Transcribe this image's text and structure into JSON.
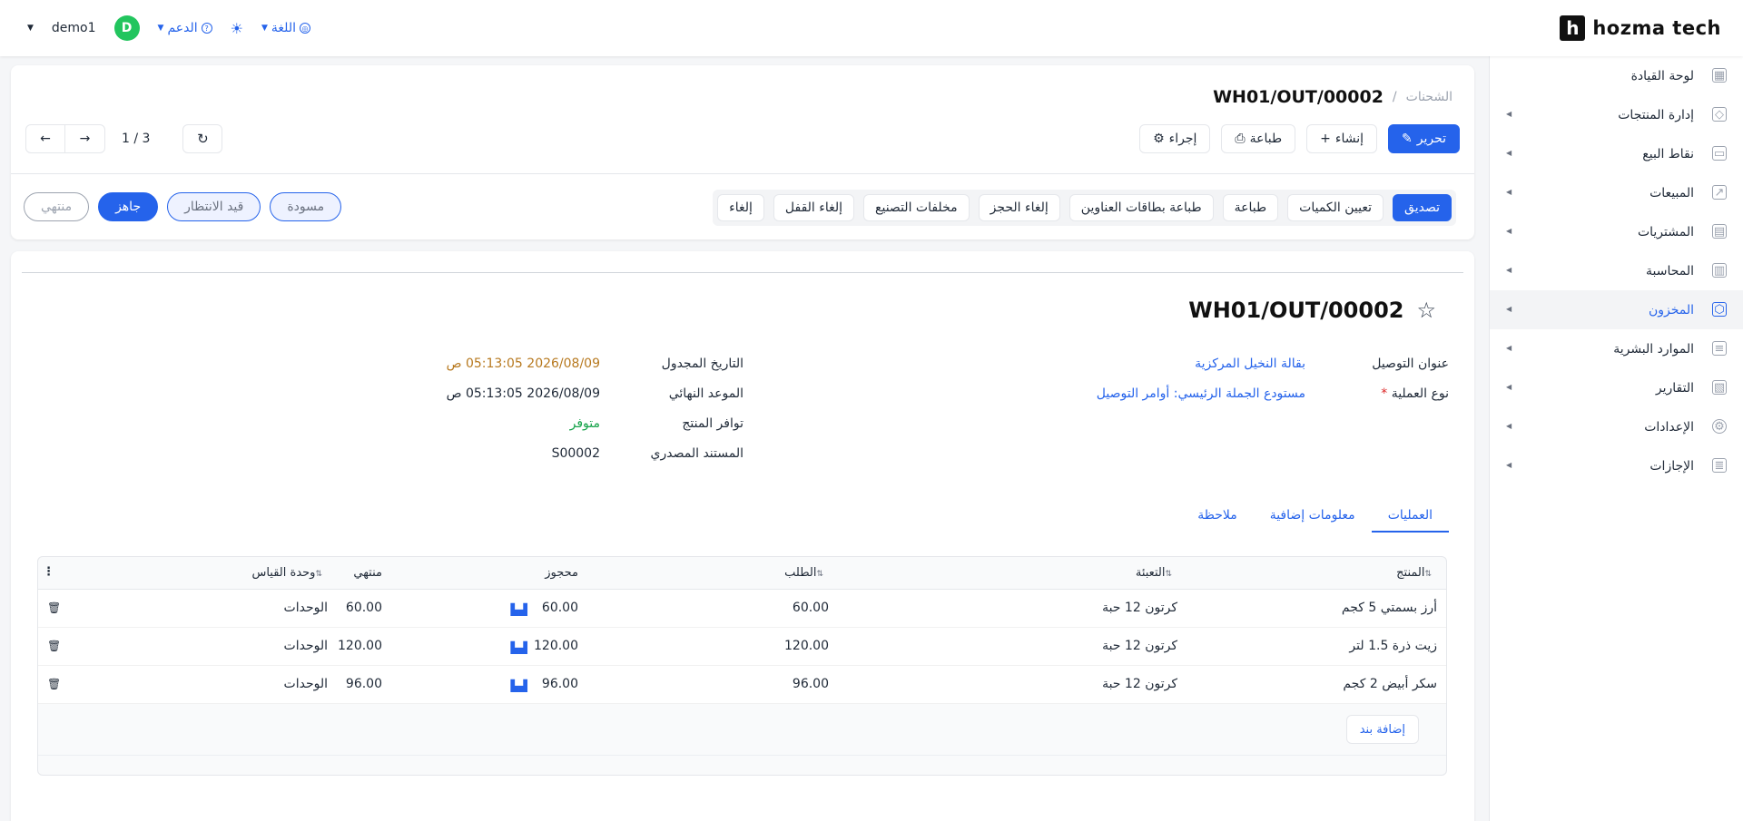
{
  "topbar": {
    "user": "demo1",
    "avatar_letter": "D",
    "support": "الدعم",
    "language": "اللغة",
    "logo_text": "hozma tech",
    "logo_mark": "h"
  },
  "sidebar": {
    "items": [
      {
        "label": "لوحة القيادة"
      },
      {
        "label": "إدارة المنتجات"
      },
      {
        "label": "نقاط البيع"
      },
      {
        "label": "المبيعات"
      },
      {
        "label": "المشتريات"
      },
      {
        "label": "المحاسبة"
      },
      {
        "label": "المخزون"
      },
      {
        "label": "الموارد البشرية"
      },
      {
        "label": "التقارير"
      },
      {
        "label": "الإعدادات"
      },
      {
        "label": "الإجازات"
      }
    ]
  },
  "header": {
    "breadcrumb_parent": "الشحنات",
    "breadcrumb_sep": "/",
    "record_ref": "WH01/OUT/00002",
    "edit": "تحرير",
    "create": "إنشاء",
    "print": "طباعة",
    "action": "إجراء",
    "pager_count": "1 / 3"
  },
  "workflow": {
    "buttons": [
      "تصديق",
      "تعيين الكميات",
      "طباعة",
      "طباعة بطاقات العناوين",
      "إلغاء الحجز",
      "مخلفات التصنيع",
      "إلغاء القفل",
      "إلغاء"
    ]
  },
  "statuses": [
    "منتهي",
    "جاهز",
    "قيد الانتظار",
    "مسودة"
  ],
  "record": {
    "title": "WH01/OUT/00002",
    "delivery_address_label": "عنوان التوصيل",
    "delivery_address": "بقالة النخيل المركزية",
    "operation_type_label": "نوع العملية",
    "operation_type_req": "*",
    "operation_type": "مستودع الجملة الرئيسي: أوامر التوصيل",
    "scheduled_label": "التاريخ المجدول",
    "scheduled": "2026/08/09 05:13:05 ص",
    "deadline_label": "الموعد النهائي",
    "deadline": "2026/08/09 05:13:05 ص",
    "availability_label": "توافر المنتج",
    "availability": "متوفر",
    "source_label": "المستند المصدري",
    "source": "S00002"
  },
  "tabs": [
    "العمليات",
    "معلومات إضافية",
    "ملاحظة"
  ],
  "table": {
    "columns": {
      "product": "المنتج",
      "packaging": "التعبئة",
      "demand": "الطلب",
      "reserved": "محجوز",
      "done": "منتهي",
      "uom": "وحدة القياس"
    },
    "rows": [
      {
        "product": "أرز بسمتي 5 كجم",
        "packaging": "كرتون 12 حبة",
        "demand": "60.00",
        "reserved": "60.00",
        "done": "60.00",
        "uom": "الوحدات"
      },
      {
        "product": "زيت ذرة 1.5 لتر",
        "packaging": "كرتون 12 حبة",
        "demand": "120.00",
        "reserved": "120.00",
        "done": "120.00",
        "uom": "الوحدات"
      },
      {
        "product": "سكر أبيض 2 كجم",
        "packaging": "كرتون 12 حبة",
        "demand": "96.00",
        "reserved": "96.00",
        "done": "96.00",
        "uom": "الوحدات"
      }
    ],
    "add_line": "إضافة بند"
  }
}
